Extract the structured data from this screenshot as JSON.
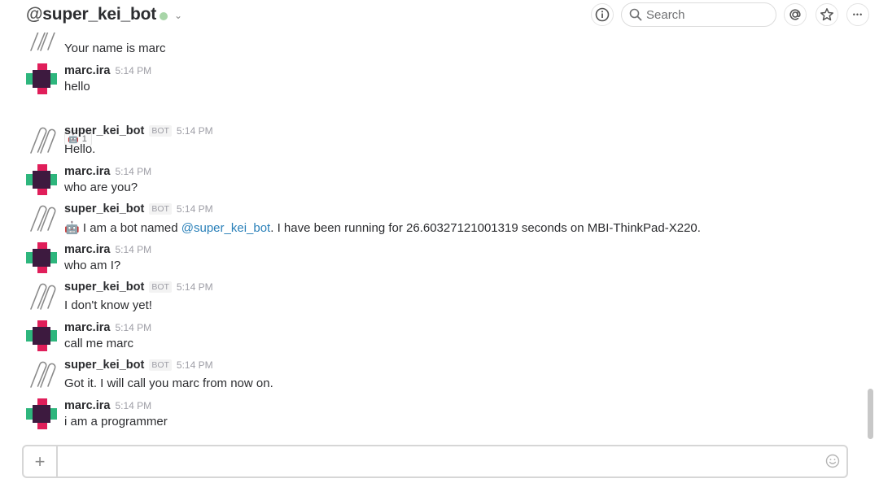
{
  "header": {
    "at_symbol": "@",
    "channel_name": "super_kei_bot",
    "chevron": "⌄",
    "search_placeholder": "Search",
    "more": "•••"
  },
  "colors": {
    "mention": "#2a80b9",
    "presence": "#a8d5a8",
    "avatar_pink": "#e01e5a",
    "avatar_green": "#2eb67d",
    "avatar_dark": "#3d1a3f"
  },
  "messages": [
    {
      "kind": "text-only",
      "text": "Your name is marc"
    },
    {
      "sender": "marc.ira",
      "bot": false,
      "time": "5:14 PM",
      "text": "hello",
      "avatar": "marc-avatar",
      "reaction": {
        "emoji": "🤖",
        "count": "1"
      }
    },
    {
      "sender": "super_kei_bot",
      "bot": true,
      "bot_tag": "BOT",
      "time": "5:14 PM",
      "text": "Hello.",
      "avatar": "paperclip-avatar"
    },
    {
      "sender": "marc.ira",
      "bot": false,
      "time": "5:14 PM",
      "text": "who are you?",
      "avatar": "marc-avatar"
    },
    {
      "sender": "super_kei_bot",
      "bot": true,
      "bot_tag": "BOT",
      "time": "5:14 PM",
      "avatar": "paperclip-avatar",
      "text_emoji": "🤖",
      "text_pre": " I am a bot named ",
      "text_mention": "@super_kei_bot",
      "text_post": ". I have been running for 26.60327121001319 seconds on MBI-ThinkPad-X220."
    },
    {
      "sender": "marc.ira",
      "bot": false,
      "time": "5:14 PM",
      "text": "who am I?",
      "avatar": "marc-avatar"
    },
    {
      "sender": "super_kei_bot",
      "bot": true,
      "bot_tag": "BOT",
      "time": "5:14 PM",
      "text": "I don't know yet!",
      "avatar": "paperclip-avatar"
    },
    {
      "sender": "marc.ira",
      "bot": false,
      "time": "5:14 PM",
      "text": "call me marc",
      "avatar": "marc-avatar"
    },
    {
      "sender": "super_kei_bot",
      "bot": true,
      "bot_tag": "BOT",
      "time": "5:14 PM",
      "text": "Got it. I will call you marc from now on.",
      "avatar": "paperclip-avatar"
    },
    {
      "sender": "marc.ira",
      "bot": false,
      "time": "5:14 PM",
      "text": "i am a programmer",
      "avatar": "marc-avatar"
    }
  ],
  "composer": {
    "plus": "+",
    "value": ""
  }
}
